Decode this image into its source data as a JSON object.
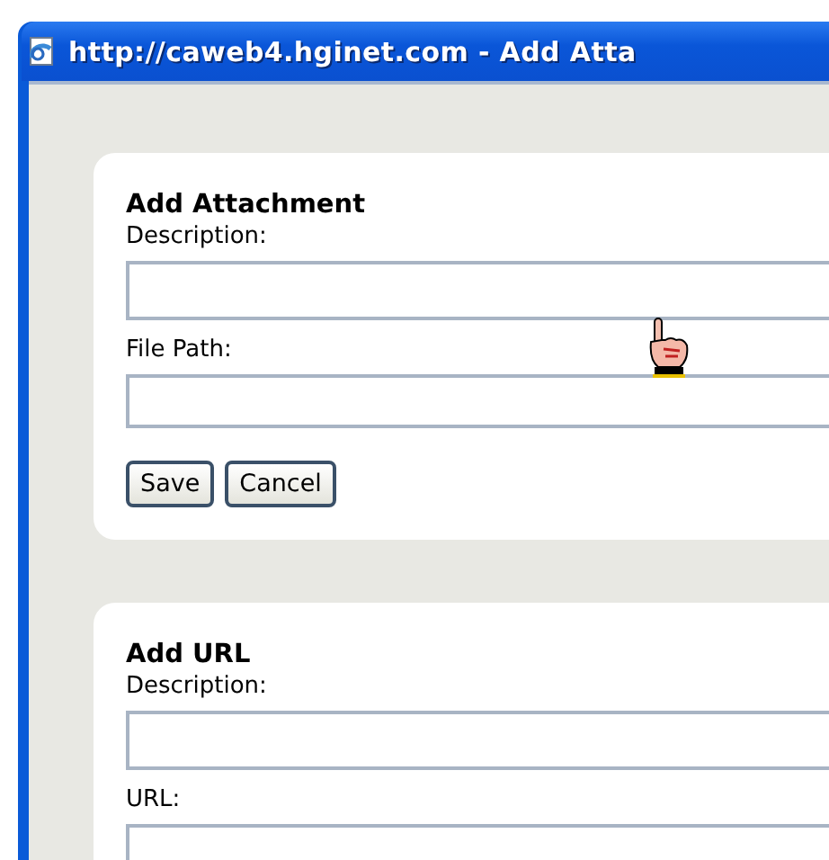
{
  "window": {
    "title": "http://caweb4.hginet.com - Add Atta"
  },
  "sections": [
    {
      "title": "Add Attachment",
      "fields": [
        {
          "label": "Description:"
        },
        {
          "label": "File Path:"
        }
      ],
      "buttons": [
        "Save",
        "Cancel"
      ]
    },
    {
      "title": "Add URL",
      "fields": [
        {
          "label": "Description:"
        },
        {
          "label": "URL:"
        }
      ]
    }
  ]
}
